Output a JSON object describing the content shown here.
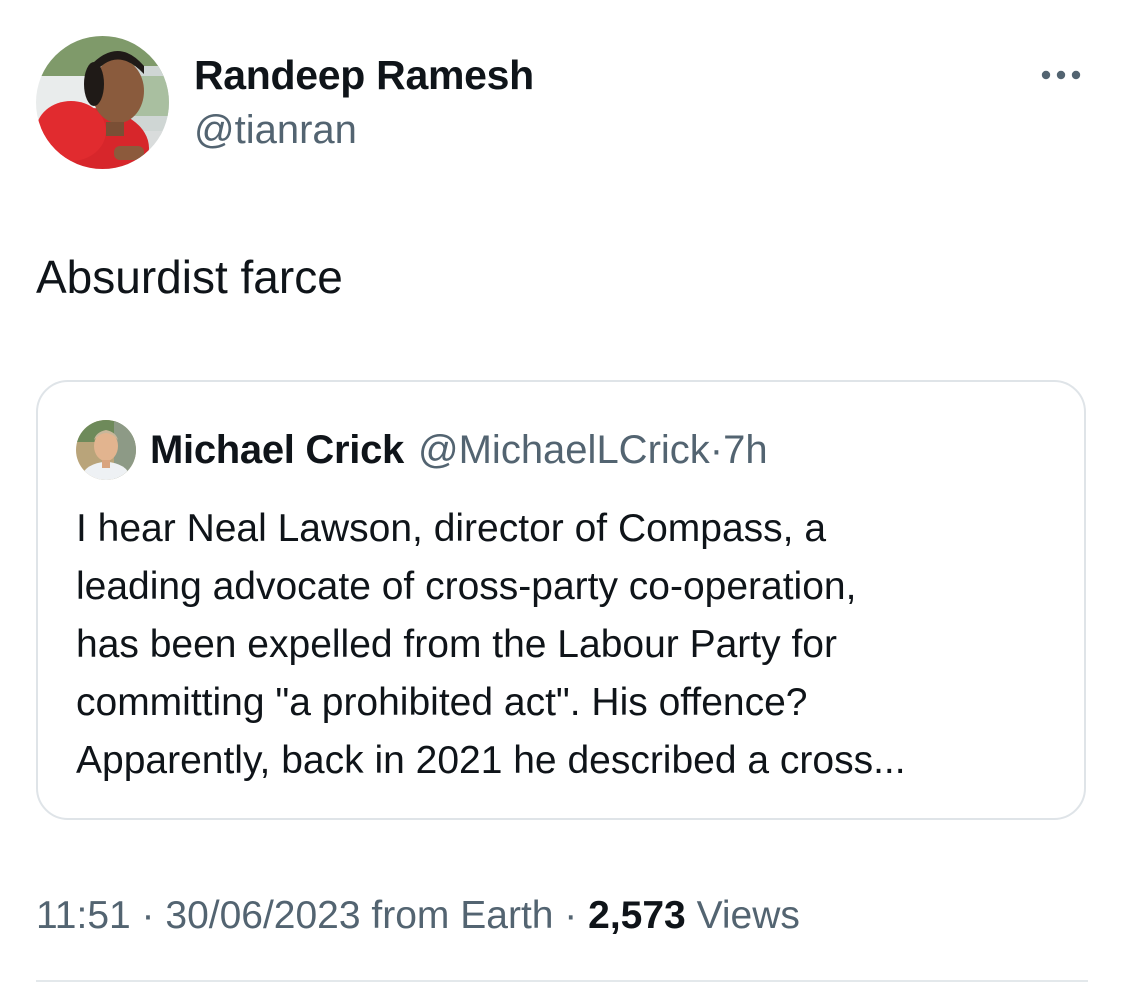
{
  "tweet": {
    "author": {
      "name": "Randeep Ramesh",
      "handle": "@tianran"
    },
    "text": "Absurdist farce",
    "quoted_tweet": {
      "author_name": "Michael Crick",
      "author_handle": "@MichaelLCrick",
      "separator": "·",
      "time": "7h",
      "text_lines": [
        "I hear Neal Lawson, director of Compass, a",
        "leading advocate of cross-party co-operation,",
        "has been expelled from the Labour Party for",
        "committing \"a prohibited act\".  His offence?",
        "Apparently, back in 2021 he described a cross..."
      ]
    },
    "meta": {
      "time": "11:51",
      "sep1": " · ",
      "date": "30/06/2023",
      "source": " from Earth",
      "sep2": " · ",
      "views_count": "2,573",
      "views_label": " Views"
    }
  },
  "icons": {
    "more": "more-horizontal-icon"
  },
  "colors": {
    "text_primary": "#0f1419",
    "text_secondary": "#536471",
    "border": "#dfe4e8"
  }
}
